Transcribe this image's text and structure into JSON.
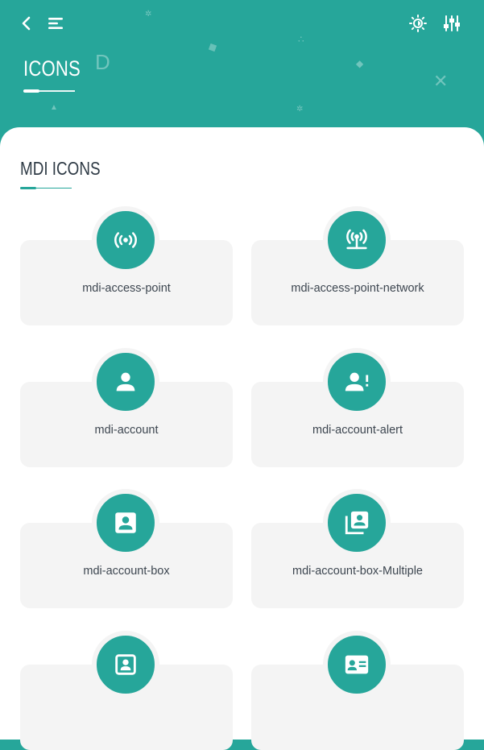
{
  "header": {
    "title": "ICONS",
    "icons": [
      "back-icon",
      "menu-icon",
      "theme-icon",
      "settings-icon"
    ]
  },
  "section": {
    "title": "MDI ICONS"
  },
  "colors": {
    "primary": "#26a69a",
    "tile_bg": "#f4f4f4",
    "text": "#3d4650"
  },
  "icons": [
    {
      "label": "mdi-access-point",
      "icon": "access-point-icon"
    },
    {
      "label": "mdi-access-point-network",
      "icon": "access-point-network-icon"
    },
    {
      "label": "mdi-account",
      "icon": "account-icon"
    },
    {
      "label": "mdi-account-alert",
      "icon": "account-alert-icon"
    },
    {
      "label": "mdi-account-box",
      "icon": "account-box-icon"
    },
    {
      "label": "mdi-account-box-Multiple",
      "icon": "account-box-multiple-icon"
    },
    {
      "label": "",
      "icon": "account-box-outline-icon"
    },
    {
      "label": "",
      "icon": "account-card-details-icon"
    }
  ]
}
